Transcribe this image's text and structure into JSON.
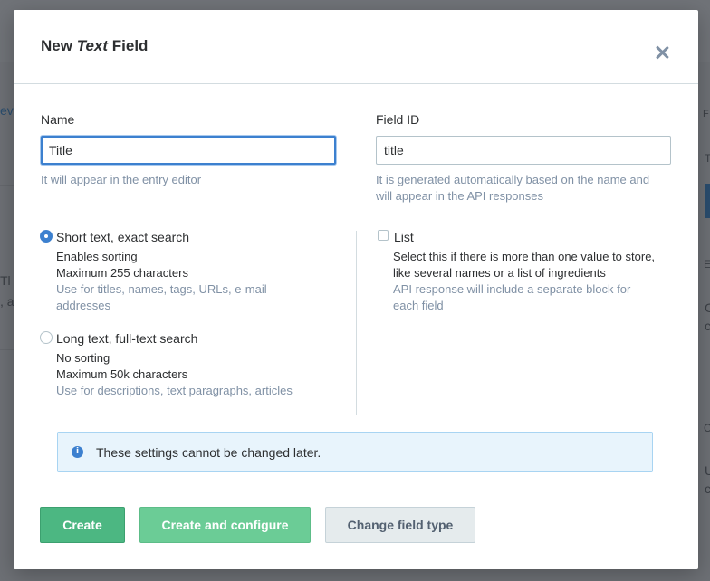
{
  "background": {
    "fragments": [
      "ev",
      "T",
      "Tl",
      ", a",
      "F",
      "E",
      "C",
      "c",
      "U",
      "c",
      "C"
    ]
  },
  "modal": {
    "title_prefix": "New",
    "title_italic": "Text",
    "title_suffix": "Field",
    "name": {
      "label": "Name",
      "value": "Title",
      "hint": "It will appear in the entry editor"
    },
    "field_id": {
      "label": "Field ID",
      "value": "title",
      "hint_line1": "It is generated automatically based on the name and",
      "hint_line2": "will appear in the API responses"
    },
    "options": {
      "short": {
        "title": "Short text, exact search",
        "line1": "Enables sorting",
        "line2": "Maximum 255 characters",
        "muted1": "Use for titles, names, tags, URLs, e-mail",
        "muted2": "addresses",
        "selected": true
      },
      "long": {
        "title": "Long text, full-text search",
        "line1": "No sorting",
        "line2": "Maximum 50k characters",
        "muted1": "Use for descriptions, text paragraphs, articles",
        "selected": false
      },
      "list": {
        "title": "List",
        "line1": "Select this if there is more than one value to store,",
        "line2": "like several names or a list of ingredients",
        "muted1": "API response will include a separate block for",
        "muted2": "each field",
        "checked": false
      }
    },
    "note": "These settings cannot be changed later.",
    "buttons": {
      "create": "Create",
      "create_configure": "Create and configure",
      "change_type": "Change field type"
    }
  },
  "colors": {
    "accent_blue": "#3c80cf",
    "primary_green": "#4cb782",
    "info_bg": "#e8f4fc"
  }
}
